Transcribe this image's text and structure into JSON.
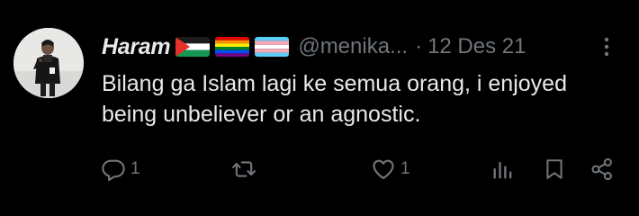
{
  "tweet": {
    "display_name": "Haram",
    "handle": "@menika...",
    "separator": "·",
    "date": "12 Des 21",
    "text": "Bilang ga Islam lagi ke semua orang, i enjoyed being unbeliever or an agnostic.",
    "flags": [
      "palestine-flag-icon",
      "rainbow-flag-icon",
      "transgender-flag-icon"
    ]
  },
  "actions": {
    "reply_count": "1",
    "retweet_count": "",
    "like_count": "1"
  },
  "colors": {
    "background": "#000000",
    "primary_text": "#e7e9ea",
    "secondary_text": "#71767b"
  }
}
